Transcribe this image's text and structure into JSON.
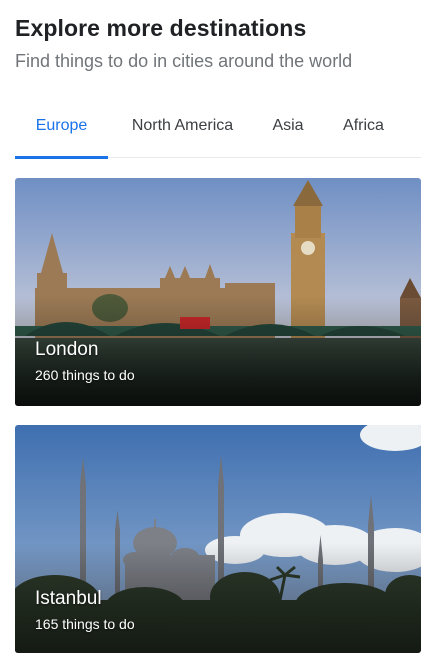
{
  "header": {
    "title": "Explore more destinations",
    "subtitle": "Find things to do in cities around the world"
  },
  "tabs": [
    {
      "label": "Europe",
      "active": true
    },
    {
      "label": "North America",
      "active": false
    },
    {
      "label": "Asia",
      "active": false
    },
    {
      "label": "Africa",
      "active": false
    }
  ],
  "destinations": [
    {
      "name": "London",
      "count": "260 things to do"
    },
    {
      "name": "Istanbul",
      "count": "165 things to do"
    }
  ],
  "colors": {
    "accent": "#1a73e8",
    "subtitle": "#70757a",
    "divider": "#e8eaed"
  }
}
